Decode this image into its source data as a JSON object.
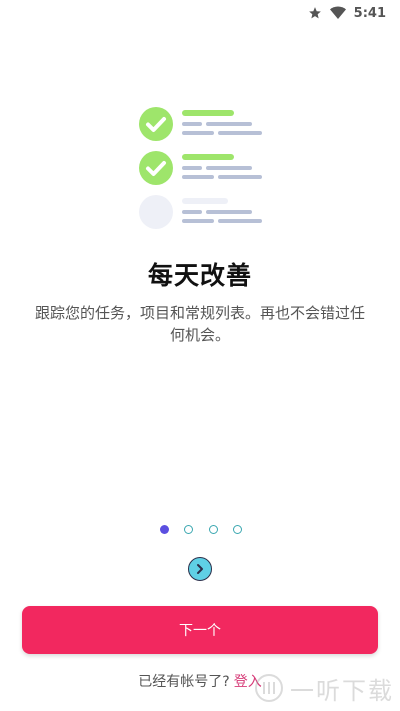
{
  "status_bar": {
    "time": "5:41",
    "icons": [
      "star-icon",
      "wifi-icon"
    ]
  },
  "onboarding": {
    "title": "每天改善",
    "description": "跟踪您的任务，项目和常规列表。再也不会错过任何机会。",
    "page_count": 4,
    "current_page": 1,
    "next_button_label": "下一个",
    "login_prompt": "已经有帐号了?",
    "login_link": "登入"
  },
  "watermark": {
    "text": "一听下载"
  },
  "colors": {
    "primary_button": "#f2285f",
    "active_dot": "#5b4fe0",
    "check_green": "#9ee56b",
    "arrow_button": "#5fd0e5",
    "login_link": "#d63a77"
  }
}
